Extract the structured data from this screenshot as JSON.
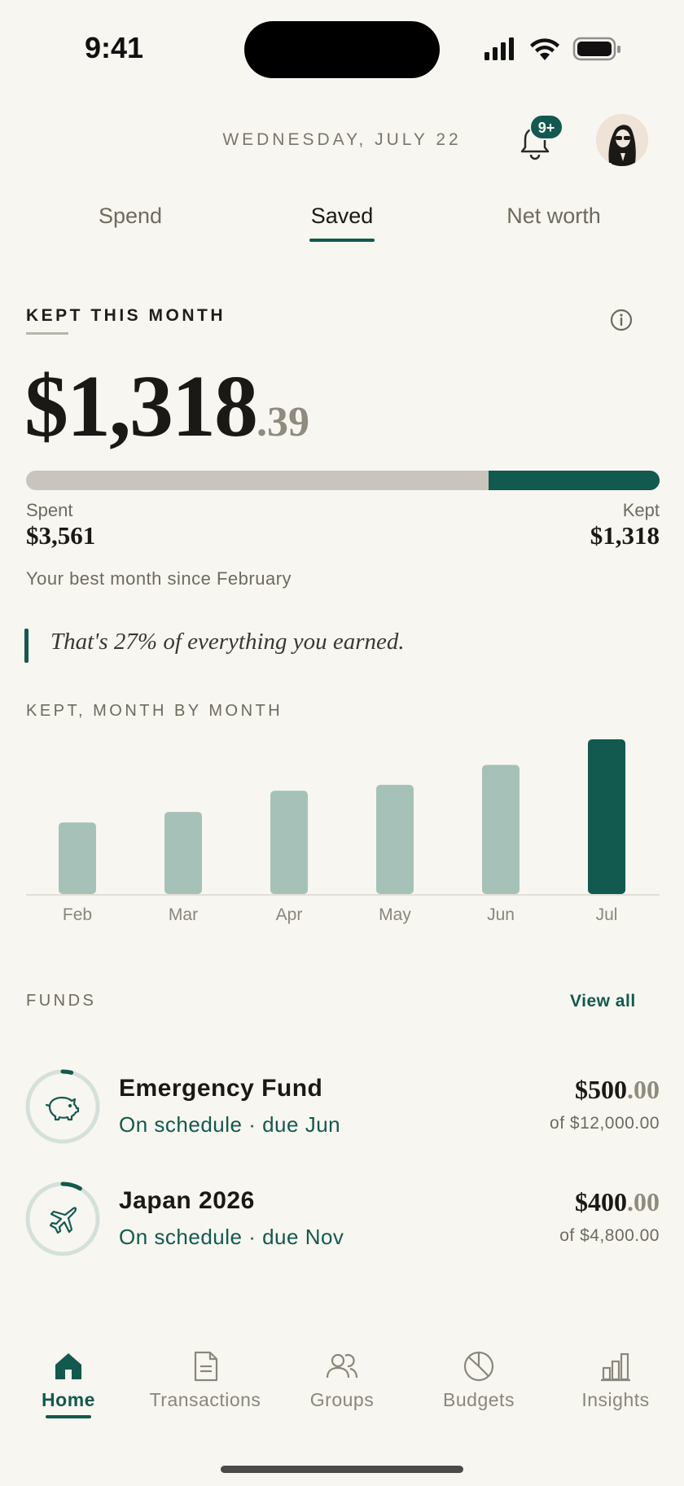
{
  "status_bar": {
    "time": "9:41"
  },
  "header": {
    "date": "WEDNESDAY, JULY 22",
    "notification_badge": "9+"
  },
  "tabs": [
    {
      "label": "Spend"
    },
    {
      "label": "Saved",
      "active": true
    },
    {
      "label": "Net worth"
    }
  ],
  "kept": {
    "title": "KEPT THIS MONTH",
    "amount_whole": "$1,318",
    "amount_cents": ".39",
    "progress_kept_fraction": 0.27,
    "spent_label": "Spent",
    "spent_value": "$3,561",
    "kept_label": "Kept",
    "kept_value": "$1,318",
    "best_month_note": "Your best month since February",
    "quote": "That's 27% of everything you earned."
  },
  "chart_data": {
    "type": "bar",
    "title": "KEPT, MONTH BY MONTH",
    "categories": [
      "Feb",
      "Mar",
      "Apr",
      "May",
      "Jun",
      "Jul"
    ],
    "values": [
      610,
      700,
      880,
      930,
      1100,
      1318
    ],
    "ylim": [
      0,
      1318
    ],
    "highlight_index": 5,
    "colors": {
      "normal": "#a6c2b8",
      "highlight": "#12594f"
    }
  },
  "funds": {
    "title": "FUNDS",
    "view_all": "View all",
    "items": [
      {
        "name": "Emergency Fund",
        "status": "On schedule · due Jun",
        "amount_whole": "$500",
        "amount_cents": ".00",
        "of_total": "of $12,000.00",
        "progress": 0.04,
        "icon": "piggy-bank-icon"
      },
      {
        "name": "Japan 2026",
        "status": "On schedule · due Nov",
        "amount_whole": "$400",
        "amount_cents": ".00",
        "of_total": "of $4,800.00",
        "progress": 0.083,
        "icon": "airplane-icon"
      }
    ]
  },
  "nav": [
    {
      "label": "Home",
      "icon": "home-icon",
      "active": true
    },
    {
      "label": "Transactions",
      "icon": "document-icon"
    },
    {
      "label": "Groups",
      "icon": "group-icon"
    },
    {
      "label": "Budgets",
      "icon": "pie-chart-icon"
    },
    {
      "label": "Insights",
      "icon": "bar-chart-icon"
    }
  ],
  "colors": {
    "accent": "#12594f",
    "background": "#f8f6f0",
    "track": "#c9c5bd"
  }
}
